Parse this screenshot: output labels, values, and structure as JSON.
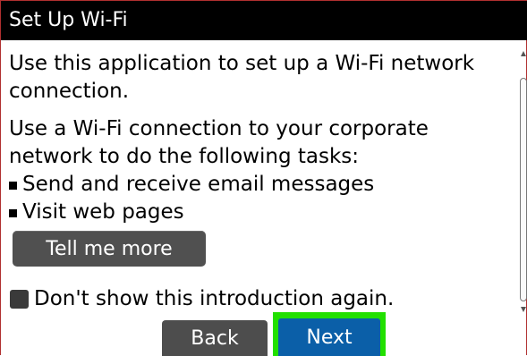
{
  "title": "Set Up Wi-Fi",
  "intro": {
    "line1": "Use this application to set up a Wi-Fi network",
    "line2": "connection.",
    "line3": "Use a Wi-Fi connection to your corporate",
    "line4": "network to do the following tasks:"
  },
  "bullets": [
    "Send and receive email messages",
    "Visit web pages"
  ],
  "tell_more_label": "Tell me more",
  "checkbox": {
    "label": "Don't show this introduction again.",
    "checked": false
  },
  "buttons": {
    "back": "Back",
    "next": "Next"
  },
  "colors": {
    "titlebar": "#000000",
    "button_gray": "#505050",
    "next_blue": "#0b5fa8",
    "focus_green": "#22e000"
  }
}
